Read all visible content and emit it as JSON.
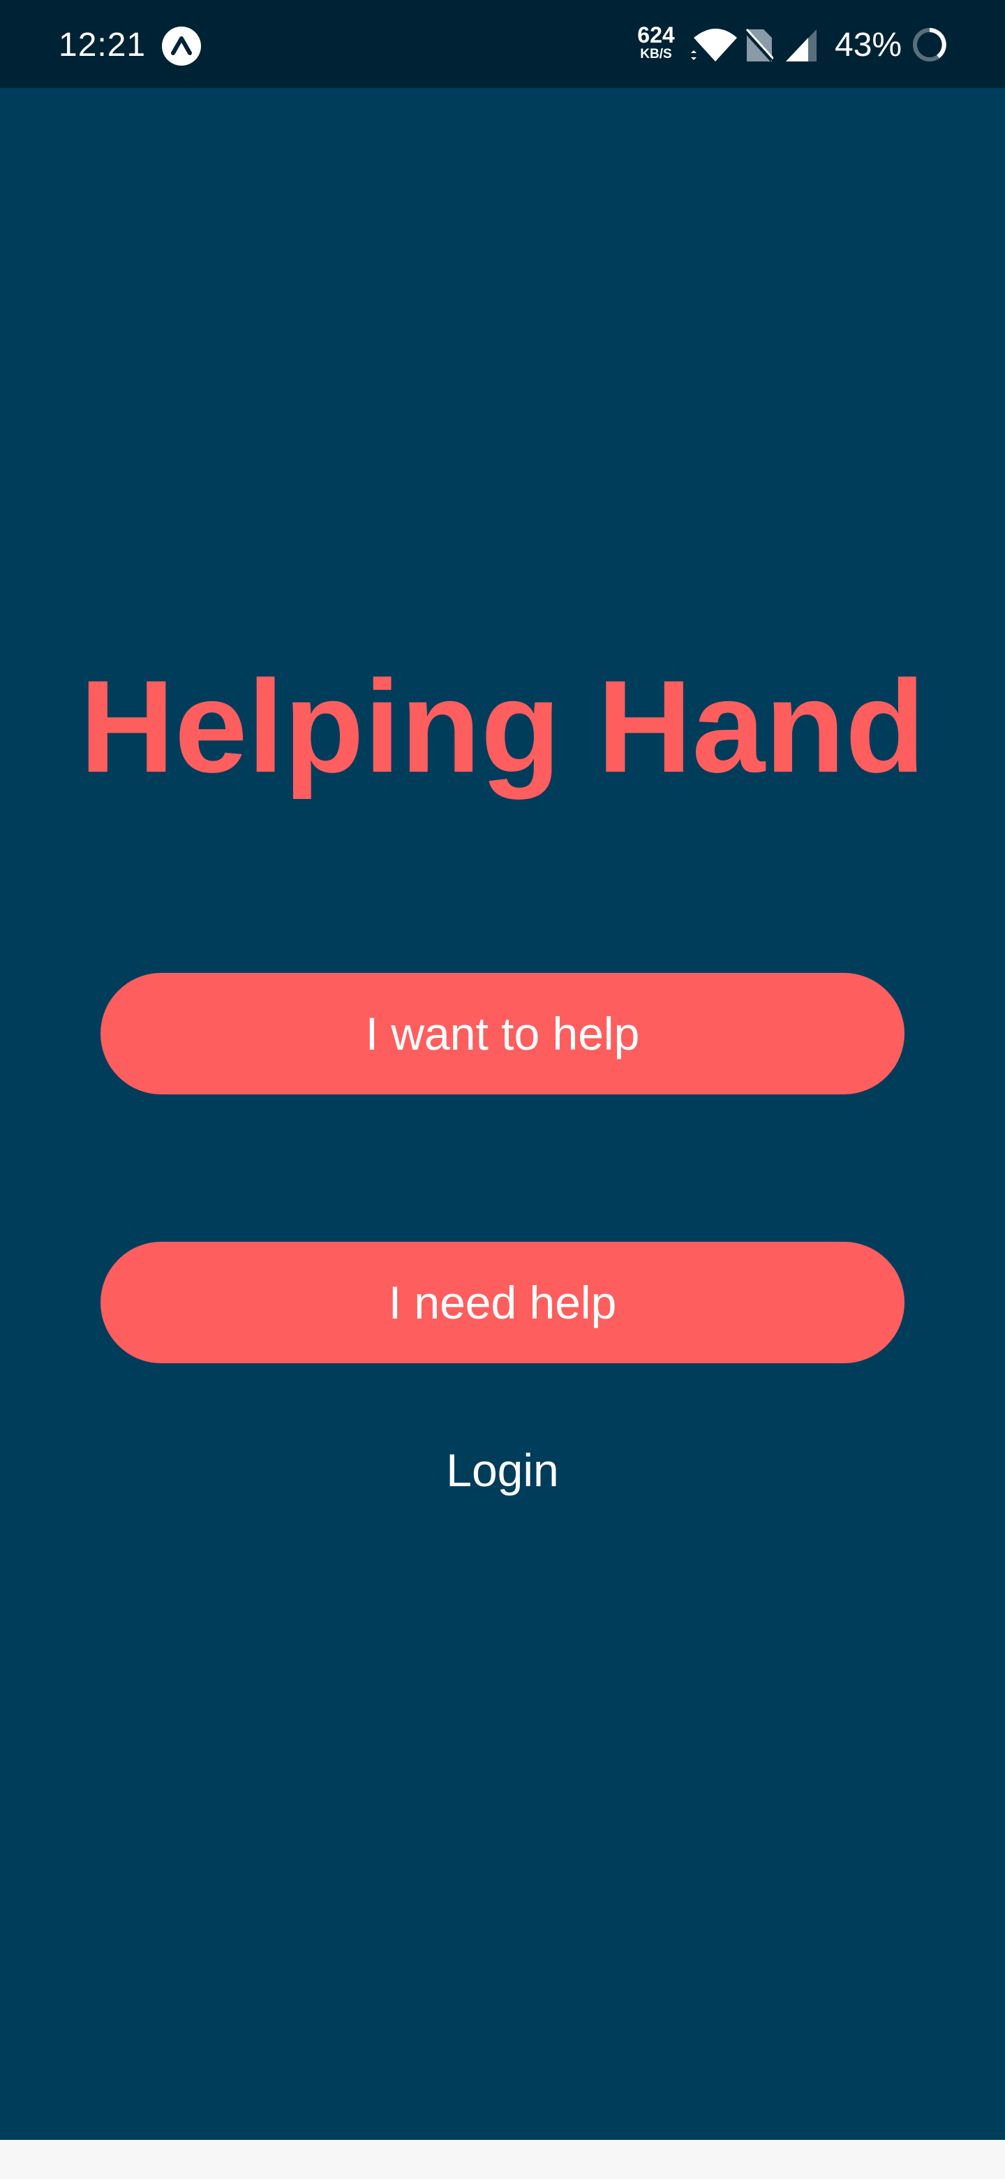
{
  "status_bar": {
    "time": "12:21",
    "net_speed_value": "624",
    "net_speed_unit": "KB/S",
    "battery_percent": "43%",
    "icons": [
      "expo-icon",
      "wifi-icon",
      "no-sim-icon",
      "cell-signal-icon",
      "battery-ring-icon"
    ]
  },
  "main": {
    "title": "Helping Hand",
    "buttons": {
      "want_to_help": "I want to help",
      "need_help": "I need help"
    },
    "login_label": "Login"
  },
  "colors": {
    "background": "#003d5b",
    "status_bar": "#002235",
    "accent": "#ff5e5e",
    "text": "#ffffff"
  }
}
